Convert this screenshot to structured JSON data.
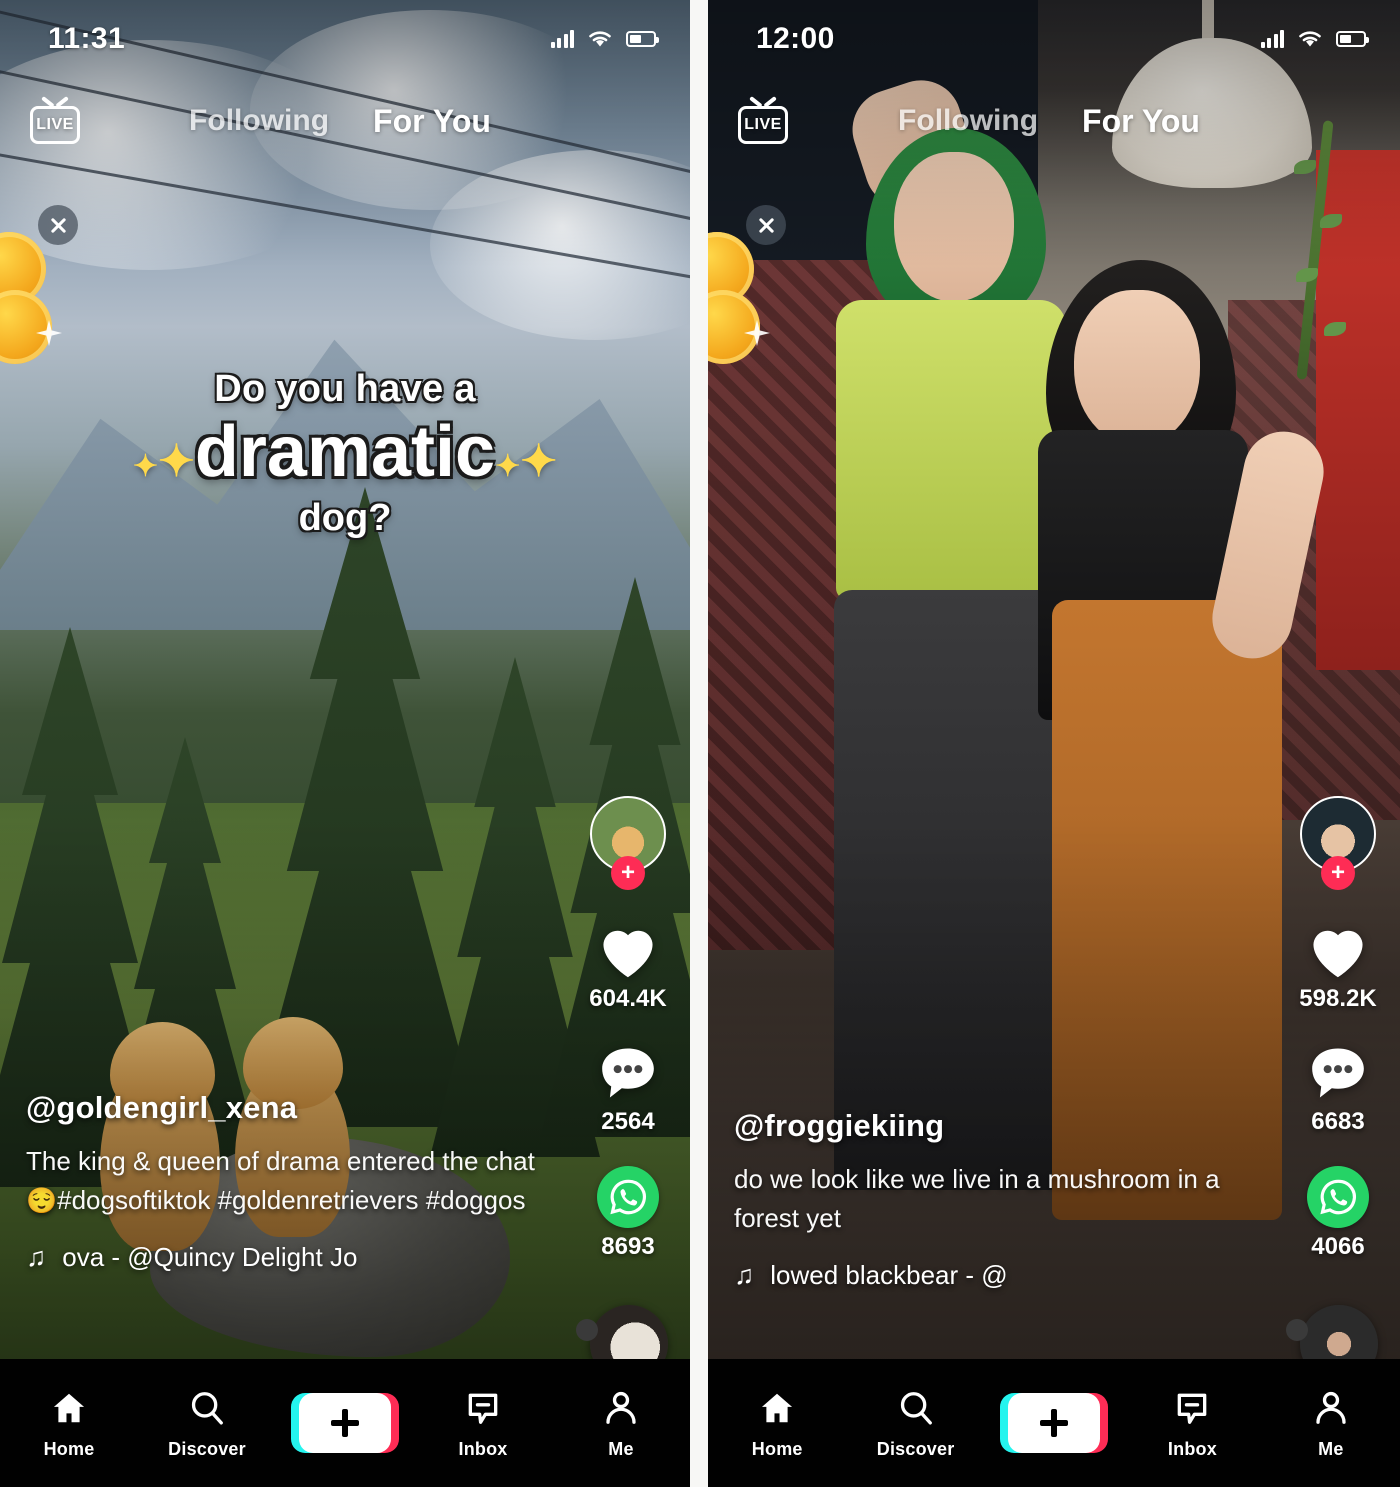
{
  "app": {
    "name": "TikTok"
  },
  "panels": [
    {
      "id": "left",
      "status": {
        "time": "11:31",
        "signal_icon": "cellular-signal-icon",
        "wifi_icon": "wifi-icon",
        "battery_icon": "battery-icon"
      },
      "topbar": {
        "live_label": "LIVE",
        "live_icon": "live-tv-icon",
        "tabs": [
          {
            "label": "Following",
            "active": false
          },
          {
            "label": "For You",
            "active": true
          }
        ]
      },
      "close_icon": "close-icon",
      "coins_icon": "gold-coins-icon",
      "sticker": {
        "line1": "Do you have a",
        "line2": "dramatic",
        "line3": "dog?",
        "sparkle": "✦"
      },
      "rail": {
        "avatar_name": "creator-avatar",
        "follow_label": "+",
        "like": {
          "icon": "heart-icon",
          "count": "604.4K"
        },
        "comment": {
          "icon": "comment-bubble-icon",
          "count": "2564"
        },
        "share": {
          "icon": "whatsapp-share-icon",
          "count": "8693"
        },
        "disc_icon": "music-disc-icon"
      },
      "caption": {
        "username": "@goldengirl_xena",
        "text_line1": "The king & queen of drama entered the",
        "text_line2_pre": "chat ",
        "emoji": "😌",
        "text_line2_post": "#dogsoftiktok #goldenretrievers",
        "text_line3": "#doggos",
        "music_note": "♫",
        "music_title": "ova - @Quincy Delight Jo"
      }
    },
    {
      "id": "right",
      "status": {
        "time": "12:00",
        "signal_icon": "cellular-signal-icon",
        "wifi_icon": "wifi-icon",
        "battery_icon": "battery-icon"
      },
      "topbar": {
        "live_label": "LIVE",
        "live_icon": "live-tv-icon",
        "tabs": [
          {
            "label": "Following",
            "active": false
          },
          {
            "label": "For You",
            "active": true
          }
        ]
      },
      "close_icon": "close-icon",
      "coins_icon": "gold-coins-icon",
      "rail": {
        "avatar_name": "creator-avatar",
        "follow_label": "+",
        "like": {
          "icon": "heart-icon",
          "count": "598.2K"
        },
        "comment": {
          "icon": "comment-bubble-icon",
          "count": "6683"
        },
        "share": {
          "icon": "whatsapp-share-icon",
          "count": "4066"
        },
        "disc_icon": "music-disc-icon"
      },
      "caption": {
        "username": "@froggiekiing",
        "text_line1": "do we look like we live in a mushroom in",
        "text_line2": "a forest yet",
        "music_note": "♫",
        "music_title": "lowed blackbear - @"
      }
    }
  ],
  "bottom_nav": {
    "items": [
      {
        "label": "Home",
        "icon": "home-icon",
        "active": true
      },
      {
        "label": "Discover",
        "icon": "search-icon",
        "active": false
      },
      {
        "label": "",
        "icon": "create-plus-icon",
        "active": false
      },
      {
        "label": "Inbox",
        "icon": "inbox-message-icon",
        "active": false
      },
      {
        "label": "Me",
        "icon": "person-icon",
        "active": false
      }
    ]
  },
  "colors": {
    "accent_red": "#fe2c55",
    "accent_cyan": "#25f4ee",
    "whatsapp_green": "#25D366",
    "nav_background": "#010101"
  }
}
